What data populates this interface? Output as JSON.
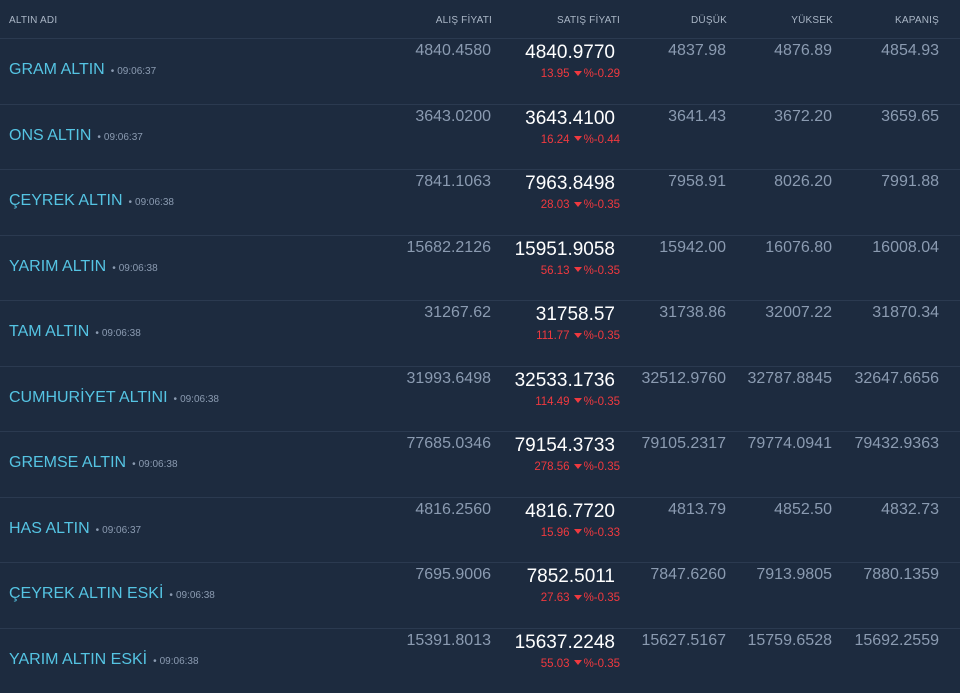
{
  "header": {
    "name": "ALTIN ADI",
    "alis": "ALIŞ FİYATI",
    "satis": "SATIŞ FİYATI",
    "dusuk": "DÜŞÜK",
    "yuksek": "YÜKSEK",
    "kapanis": "KAPANIŞ"
  },
  "colors": {
    "background": "#1d2b3f",
    "name": "#55c4e3",
    "negative": "#f0393f",
    "sell": "#ffffff",
    "muted": "#8b9bb1"
  },
  "icons": {
    "change_down": "triangle-down-icon"
  },
  "rows": [
    {
      "name": "GRAM ALTIN",
      "time": "09:06:37",
      "alis": "4840.4580",
      "satis": "4840.9770",
      "change": "13.95",
      "percent": "%-0.29",
      "dusuk": "4837.98",
      "yuksek": "4876.89",
      "kapanis": "4854.93"
    },
    {
      "name": "ONS ALTIN",
      "time": "09:06:37",
      "alis": "3643.0200",
      "satis": "3643.4100",
      "change": "16.24",
      "percent": "%-0.44",
      "dusuk": "3641.43",
      "yuksek": "3672.20",
      "kapanis": "3659.65"
    },
    {
      "name": "ÇEYREK ALTIN",
      "time": "09:06:38",
      "alis": "7841.1063",
      "satis": "7963.8498",
      "change": "28.03",
      "percent": "%-0.35",
      "dusuk": "7958.91",
      "yuksek": "8026.20",
      "kapanis": "7991.88"
    },
    {
      "name": "YARIM ALTIN",
      "time": "09:06:38",
      "alis": "15682.2126",
      "satis": "15951.9058",
      "change": "56.13",
      "percent": "%-0.35",
      "dusuk": "15942.00",
      "yuksek": "16076.80",
      "kapanis": "16008.04"
    },
    {
      "name": "TAM ALTIN",
      "time": "09:06:38",
      "alis": "31267.62",
      "satis": "31758.57",
      "change": "111.77",
      "percent": "%-0.35",
      "dusuk": "31738.86",
      "yuksek": "32007.22",
      "kapanis": "31870.34"
    },
    {
      "name": "CUMHURİYET ALTINI",
      "time": "09:06:38",
      "alis": "31993.6498",
      "satis": "32533.1736",
      "change": "114.49",
      "percent": "%-0.35",
      "dusuk": "32512.9760",
      "yuksek": "32787.8845",
      "kapanis": "32647.6656"
    },
    {
      "name": "GREMSE ALTIN",
      "time": "09:06:38",
      "alis": "77685.0346",
      "satis": "79154.3733",
      "change": "278.56",
      "percent": "%-0.35",
      "dusuk": "79105.2317",
      "yuksek": "79774.0941",
      "kapanis": "79432.9363"
    },
    {
      "name": "HAS ALTIN",
      "time": "09:06:37",
      "alis": "4816.2560",
      "satis": "4816.7720",
      "change": "15.96",
      "percent": "%-0.33",
      "dusuk": "4813.79",
      "yuksek": "4852.50",
      "kapanis": "4832.73"
    },
    {
      "name": "ÇEYREK ALTIN ESKİ",
      "time": "09:06:38",
      "alis": "7695.9006",
      "satis": "7852.5011",
      "change": "27.63",
      "percent": "%-0.35",
      "dusuk": "7847.6260",
      "yuksek": "7913.9805",
      "kapanis": "7880.1359"
    },
    {
      "name": "YARIM ALTIN ESKİ",
      "time": "09:06:38",
      "alis": "15391.8013",
      "satis": "15637.2248",
      "change": "55.03",
      "percent": "%-0.35",
      "dusuk": "15627.5167",
      "yuksek": "15759.6528",
      "kapanis": "15692.2559"
    }
  ]
}
